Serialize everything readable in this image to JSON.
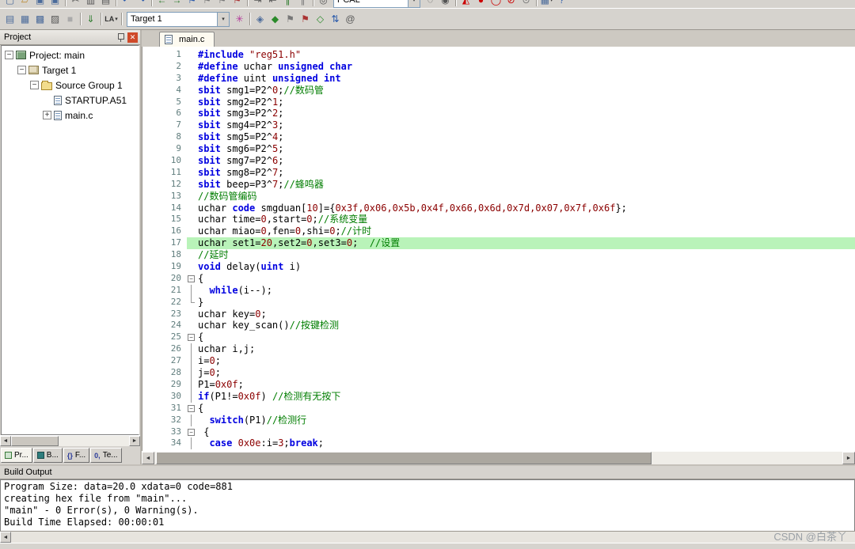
{
  "icons": {
    "left": "◄",
    "right": "►",
    "down": "▾",
    "expander_minus": "−",
    "expander_plus": "+",
    "fold_minus": "−",
    "close_glyph": "✕"
  },
  "colors": {
    "toolbar_bg": "#d6d3ce",
    "keyword": "#0000e0",
    "comment": "#007d00",
    "string": "#8b0000",
    "number": "#8b0000",
    "line_highlight": "#b9f3b9",
    "close_button": "#cf4a2a"
  },
  "toolbar_top": {
    "items": [
      {
        "name": "new-file-icon",
        "glyph": "▢",
        "color": "#4a6a9a"
      },
      {
        "name": "open-file-icon",
        "glyph": "▱",
        "color": "#b9862a"
      },
      {
        "name": "save-icon",
        "glyph": "▣",
        "color": "#4a6a9a"
      },
      {
        "name": "save-all-icon",
        "glyph": "▣",
        "color": "#4a6a9a"
      },
      {
        "type": "sep"
      },
      {
        "name": "cut-icon",
        "glyph": "✂",
        "color": "#555555"
      },
      {
        "name": "copy-icon",
        "glyph": "▥",
        "color": "#555555"
      },
      {
        "name": "paste-icon",
        "glyph": "▤",
        "color": "#555555"
      },
      {
        "type": "sep"
      },
      {
        "name": "undo-icon",
        "glyph": "↶",
        "color": "#2a5aaa"
      },
      {
        "name": "redo-icon",
        "glyph": "↷",
        "color": "#2a5aaa"
      },
      {
        "type": "sep"
      },
      {
        "name": "jump-back-icon",
        "glyph": "←",
        "color": "#2a7a2a"
      },
      {
        "name": "jump-forward-icon",
        "glyph": "→",
        "color": "#2a7a2a"
      },
      {
        "name": "bookmark-icon",
        "glyph": "⚑",
        "color": "#2a5aaa"
      },
      {
        "name": "prev-bookmark-icon",
        "glyph": "⚑",
        "color": "#777777"
      },
      {
        "name": "next-bookmark-icon",
        "glyph": "⚑",
        "color": "#777777"
      },
      {
        "name": "clear-bookmarks-icon",
        "glyph": "⚑",
        "color": "#aa3333"
      },
      {
        "type": "sep"
      },
      {
        "name": "indent-icon",
        "glyph": "⇥",
        "color": "#555555"
      },
      {
        "name": "outdent-icon",
        "glyph": "⇤",
        "color": "#555555"
      },
      {
        "name": "comment-icon",
        "glyph": "∥",
        "color": "#2a7a2a"
      },
      {
        "name": "uncomment-icon",
        "glyph": "∥",
        "color": "#777777"
      },
      {
        "type": "sep"
      },
      {
        "name": "find-in-files-icon",
        "glyph": "◎",
        "color": "#555555"
      },
      {
        "type": "combo",
        "name": "find-combo",
        "value": "PCAL",
        "width": 110
      },
      {
        "name": "find-icon",
        "glyph": "◌",
        "color": "#555555"
      },
      {
        "name": "incremental-find-icon",
        "glyph": "◉",
        "color": "#555555"
      },
      {
        "type": "sep"
      },
      {
        "name": "start-stop-debug-icon",
        "glyph": "◭",
        "color": "#cc0000"
      },
      {
        "name": "insert-breakpoint-icon",
        "glyph": "●",
        "color": "#cc0000"
      },
      {
        "name": "disable-breakpoint-icon",
        "glyph": "◯",
        "color": "#cc0000"
      },
      {
        "name": "kill-breakpoints-icon",
        "glyph": "⊘",
        "color": "#cc0000"
      },
      {
        "name": "enable-breakpoints-icon",
        "glyph": "⊙",
        "color": "#777777"
      },
      {
        "type": "sep"
      },
      {
        "name": "windows-icon",
        "glyph": "▦",
        "color": "#4a6a9a",
        "dropdown": true
      },
      {
        "name": "help-icon",
        "glyph": "?",
        "color": "#2a5aaa"
      }
    ]
  },
  "toolbar_build": {
    "items": [
      {
        "name": "translate-file-icon",
        "glyph": "▤",
        "color": "#4a6a9a"
      },
      {
        "name": "build-icon",
        "glyph": "▦",
        "color": "#4a6a9a"
      },
      {
        "name": "rebuild-all-icon",
        "glyph": "▩",
        "color": "#4a6a9a"
      },
      {
        "name": "batch-build-icon",
        "glyph": "▨",
        "color": "#555555"
      },
      {
        "name": "stop-build-icon",
        "glyph": "■",
        "color": "#aaaaaa"
      },
      {
        "type": "sep"
      },
      {
        "name": "download-icon",
        "glyph": "⇓",
        "color": "#2a7a2a"
      },
      {
        "type": "sep"
      },
      {
        "name": "logic-analyzer-icon",
        "glyph": "LA",
        "small": true,
        "color": "#333333",
        "dropdown": true
      },
      {
        "type": "sep"
      },
      {
        "type": "combo",
        "name": "target-combo",
        "value": "Target 1",
        "width": 130
      },
      {
        "name": "options-for-target-icon",
        "glyph": "✳",
        "color": "#b3399a"
      },
      {
        "type": "sep"
      },
      {
        "name": "file-extensions-icon",
        "glyph": "◈",
        "color": "#4a6a9a"
      },
      {
        "name": "cube-icon",
        "glyph": "◆",
        "color": "#2a8a2a"
      },
      {
        "name": "flag-icon",
        "glyph": "⚑",
        "color": "#777777"
      },
      {
        "name": "flag-red-icon",
        "glyph": "⚑",
        "color": "#aa3333"
      },
      {
        "name": "diamond-icon",
        "glyph": "◇",
        "color": "#2a8a2a"
      },
      {
        "name": "navigate-icon",
        "glyph": "⇅",
        "color": "#2a5aaa"
      },
      {
        "name": "spiral-icon",
        "glyph": "@",
        "color": "#555555"
      }
    ]
  },
  "project_panel": {
    "title": "Project",
    "tree": [
      {
        "key": "project-main",
        "label": "Project: main",
        "level": 0,
        "icon": "project",
        "expander": "minus"
      },
      {
        "key": "target-1",
        "label": "Target 1",
        "level": 1,
        "icon": "target",
        "expander": "minus"
      },
      {
        "key": "source-group-1",
        "label": "Source Group 1",
        "level": 2,
        "icon": "folder",
        "expander": "minus"
      },
      {
        "key": "startup-a51",
        "label": "STARTUP.A51",
        "level": 3,
        "icon": "file",
        "expander": ""
      },
      {
        "key": "main-c",
        "label": "main.c",
        "level": 3,
        "icon": "file",
        "expander": "plus"
      }
    ]
  },
  "panel_tabs": [
    {
      "key": "project",
      "icon_type": "grid",
      "label": "Pr...",
      "active": true
    },
    {
      "key": "books",
      "icon_type": "book",
      "label": "B...",
      "active": false
    },
    {
      "key": "functions",
      "icon_type": "text",
      "icon_text": "{}",
      "label": "F...",
      "active": false
    },
    {
      "key": "templates",
      "icon_type": "text",
      "icon_text": "0,",
      "label": "Te...",
      "active": false
    }
  ],
  "editor": {
    "tab_label": "main.c",
    "lines": [
      {
        "n": 1,
        "fold": "",
        "toks": [
          [
            "kw",
            "#include "
          ],
          [
            "str",
            "\"reg51.h\""
          ]
        ]
      },
      {
        "n": 2,
        "fold": "",
        "toks": [
          [
            "kw",
            "#define"
          ],
          [
            "pl",
            " uchar "
          ],
          [
            "kw",
            "unsigned char"
          ]
        ]
      },
      {
        "n": 3,
        "fold": "",
        "toks": [
          [
            "kw",
            "#define"
          ],
          [
            "pl",
            " uint "
          ],
          [
            "kw",
            "unsigned int"
          ]
        ]
      },
      {
        "n": 4,
        "fold": "",
        "toks": [
          [
            "kw",
            "sbit"
          ],
          [
            "pl",
            " smg1=P2^"
          ],
          [
            "num",
            "0"
          ],
          [
            "pl",
            ";"
          ],
          [
            "cmt",
            "//数码管"
          ]
        ]
      },
      {
        "n": 5,
        "fold": "",
        "toks": [
          [
            "kw",
            "sbit"
          ],
          [
            "pl",
            " smg2=P2^"
          ],
          [
            "num",
            "1"
          ],
          [
            "pl",
            ";"
          ]
        ]
      },
      {
        "n": 6,
        "fold": "",
        "toks": [
          [
            "kw",
            "sbit"
          ],
          [
            "pl",
            " smg3=P2^"
          ],
          [
            "num",
            "2"
          ],
          [
            "pl",
            ";"
          ]
        ]
      },
      {
        "n": 7,
        "fold": "",
        "toks": [
          [
            "kw",
            "sbit"
          ],
          [
            "pl",
            " smg4=P2^"
          ],
          [
            "num",
            "3"
          ],
          [
            "pl",
            ";"
          ]
        ]
      },
      {
        "n": 8,
        "fold": "",
        "toks": [
          [
            "kw",
            "sbit"
          ],
          [
            "pl",
            " smg5=P2^"
          ],
          [
            "num",
            "4"
          ],
          [
            "pl",
            ";"
          ]
        ]
      },
      {
        "n": 9,
        "fold": "",
        "toks": [
          [
            "kw",
            "sbit"
          ],
          [
            "pl",
            " smg6=P2^"
          ],
          [
            "num",
            "5"
          ],
          [
            "pl",
            ";"
          ]
        ]
      },
      {
        "n": 10,
        "fold": "",
        "toks": [
          [
            "kw",
            "sbit"
          ],
          [
            "pl",
            " smg7=P2^"
          ],
          [
            "num",
            "6"
          ],
          [
            "pl",
            ";"
          ]
        ]
      },
      {
        "n": 11,
        "fold": "",
        "toks": [
          [
            "kw",
            "sbit"
          ],
          [
            "pl",
            " smg8=P2^"
          ],
          [
            "num",
            "7"
          ],
          [
            "pl",
            ";"
          ]
        ]
      },
      {
        "n": 12,
        "fold": "",
        "toks": [
          [
            "kw",
            "sbit"
          ],
          [
            "pl",
            " beep=P3^"
          ],
          [
            "num",
            "7"
          ],
          [
            "pl",
            ";"
          ],
          [
            "cmt",
            "//蜂鸣器"
          ]
        ]
      },
      {
        "n": 13,
        "fold": "",
        "toks": [
          [
            "cmt",
            "//数码管编码"
          ]
        ]
      },
      {
        "n": 14,
        "fold": "",
        "toks": [
          [
            "pl",
            "uchar "
          ],
          [
            "kw",
            "code"
          ],
          [
            "pl",
            " smgduan["
          ],
          [
            "num",
            "10"
          ],
          [
            "pl",
            "]={"
          ],
          [
            "num",
            "0x3f,0x06,0x5b,0x4f,0x66,0x6d,0x7d,0x07,0x7f,0x6f"
          ],
          [
            "pl",
            "};"
          ]
        ]
      },
      {
        "n": 15,
        "fold": "",
        "toks": [
          [
            "pl",
            "uchar time="
          ],
          [
            "num",
            "0"
          ],
          [
            "pl",
            ",start="
          ],
          [
            "num",
            "0"
          ],
          [
            "pl",
            ";"
          ],
          [
            "cmt",
            "//系统变量"
          ]
        ]
      },
      {
        "n": 16,
        "fold": "",
        "toks": [
          [
            "pl",
            "uchar miao="
          ],
          [
            "num",
            "0"
          ],
          [
            "pl",
            ",fen="
          ],
          [
            "num",
            "0"
          ],
          [
            "pl",
            ",shi="
          ],
          [
            "num",
            "0"
          ],
          [
            "pl",
            ";"
          ],
          [
            "cmt",
            "//计时"
          ]
        ]
      },
      {
        "n": 17,
        "fold": "",
        "hl": true,
        "toks": [
          [
            "pl",
            "uchar set1="
          ],
          [
            "num",
            "20"
          ],
          [
            "pl",
            ",set2="
          ],
          [
            "num",
            "0"
          ],
          [
            "pl",
            ",set3="
          ],
          [
            "num",
            "0"
          ],
          [
            "pl",
            ";  "
          ],
          [
            "cmt",
            "//设置"
          ]
        ]
      },
      {
        "n": 18,
        "fold": "",
        "toks": [
          [
            "cmt",
            "//延时"
          ]
        ]
      },
      {
        "n": 19,
        "fold": "",
        "toks": [
          [
            "kw",
            "void"
          ],
          [
            "pl",
            " delay("
          ],
          [
            "kw",
            "uint"
          ],
          [
            "pl",
            " i)"
          ]
        ]
      },
      {
        "n": 20,
        "fold": "box",
        "toks": [
          [
            "pl",
            "{"
          ]
        ]
      },
      {
        "n": 21,
        "fold": "line",
        "toks": [
          [
            "pl",
            "  "
          ],
          [
            "kw",
            "while"
          ],
          [
            "pl",
            "(i--);"
          ]
        ]
      },
      {
        "n": 22,
        "fold": "end",
        "toks": [
          [
            "pl",
            "}"
          ]
        ]
      },
      {
        "n": 23,
        "fold": "",
        "toks": [
          [
            "pl",
            "uchar key="
          ],
          [
            "num",
            "0"
          ],
          [
            "pl",
            ";"
          ]
        ]
      },
      {
        "n": 24,
        "fold": "",
        "toks": [
          [
            "pl",
            "uchar key_scan()"
          ],
          [
            "cmt",
            "//按键检测"
          ]
        ]
      },
      {
        "n": 25,
        "fold": "box",
        "toks": [
          [
            "pl",
            "{"
          ]
        ]
      },
      {
        "n": 26,
        "fold": "line",
        "toks": [
          [
            "pl",
            "uchar i,j;"
          ]
        ]
      },
      {
        "n": 27,
        "fold": "line",
        "toks": [
          [
            "pl",
            "i="
          ],
          [
            "num",
            "0"
          ],
          [
            "pl",
            ";"
          ]
        ]
      },
      {
        "n": 28,
        "fold": "line",
        "toks": [
          [
            "pl",
            "j="
          ],
          [
            "num",
            "0"
          ],
          [
            "pl",
            ";"
          ]
        ]
      },
      {
        "n": 29,
        "fold": "line",
        "toks": [
          [
            "pl",
            "P1="
          ],
          [
            "num",
            "0x0f"
          ],
          [
            "pl",
            ";"
          ]
        ]
      },
      {
        "n": 30,
        "fold": "line",
        "toks": [
          [
            "kw",
            "if"
          ],
          [
            "pl",
            "(P1!="
          ],
          [
            "num",
            "0x0f"
          ],
          [
            "pl",
            ") "
          ],
          [
            "cmt",
            "//检测有无按下"
          ]
        ]
      },
      {
        "n": 31,
        "fold": "box",
        "toks": [
          [
            "pl",
            "{"
          ]
        ]
      },
      {
        "n": 32,
        "fold": "line",
        "toks": [
          [
            "pl",
            "  "
          ],
          [
            "kw",
            "switch"
          ],
          [
            "pl",
            "(P1)"
          ],
          [
            "cmt",
            "//检测行"
          ]
        ]
      },
      {
        "n": 33,
        "fold": "box",
        "toks": [
          [
            "pl",
            " {"
          ]
        ]
      },
      {
        "n": 34,
        "fold": "line",
        "toks": [
          [
            "pl",
            "  "
          ],
          [
            "kw",
            "case"
          ],
          [
            "pl",
            " "
          ],
          [
            "num",
            "0x0e"
          ],
          [
            "pl",
            ":i="
          ],
          [
            "num",
            "3"
          ],
          [
            "pl",
            ";"
          ],
          [
            "kw",
            "break"
          ],
          [
            "pl",
            ";"
          ]
        ]
      }
    ]
  },
  "build_output": {
    "title": "Build Output",
    "lines": [
      "Program Size: data=20.0 xdata=0 code=881",
      "creating hex file from \"main\"...",
      "\"main\" - 0 Error(s), 0 Warning(s).",
      "Build Time Elapsed:  00:00:01"
    ]
  },
  "watermark": "CSDN @白茶丫"
}
